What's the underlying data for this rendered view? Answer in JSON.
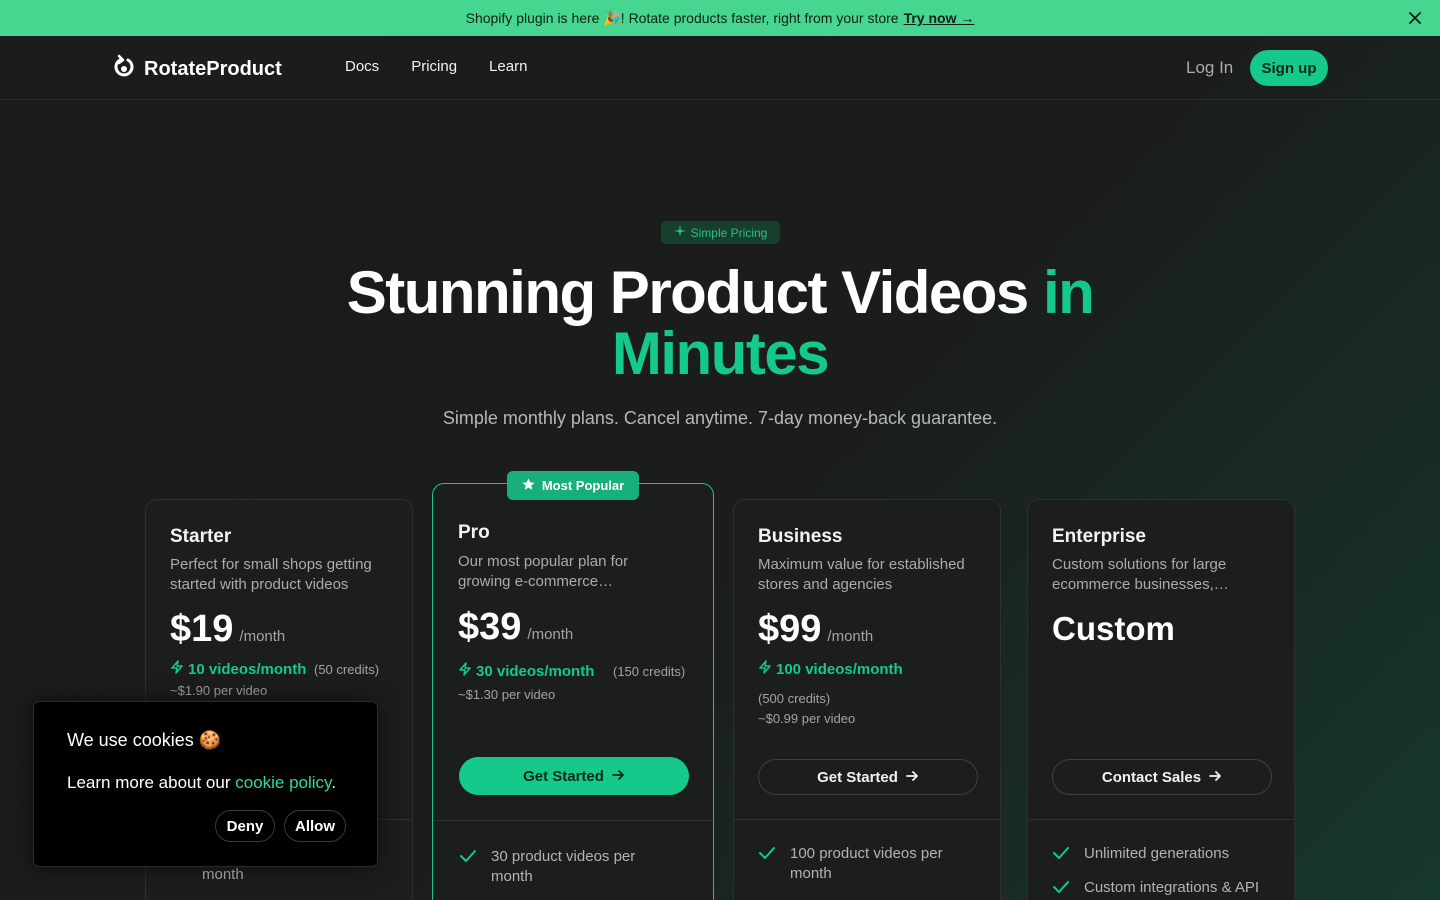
{
  "banner": {
    "text": "Shopify plugin is here 🎉! Rotate products faster, right from your store",
    "link": "Try now →"
  },
  "nav": {
    "logo": "RotateProduct",
    "links": [
      "Docs",
      "Pricing",
      "Learn"
    ],
    "login": "Log In",
    "signup": "Sign up"
  },
  "hero": {
    "pill": "Simple Pricing",
    "title_white": "Stunning Product Videos",
    "title_green_1": "in",
    "title_green_2": "Minutes",
    "subtitle": "Simple monthly plans. Cancel anytime. 7-day money-back guarantee."
  },
  "plans": {
    "starter": {
      "name": "Starter",
      "desc": "Perfect for small shops getting started with product videos",
      "price": "$19",
      "per": "/month",
      "videos": "10 videos/month",
      "credits": "(50 credits)",
      "per_video": "~$1.90 per video",
      "feature_tail": "month"
    },
    "pro": {
      "badge": "Most Popular",
      "name": "Pro",
      "desc": "Our most popular plan for growing e-commerce…",
      "price": "$39",
      "per": "/month",
      "videos": "30 videos/month",
      "credits": "(150 credits)",
      "per_video": "~$1.30 per video",
      "cta": "Get Started",
      "feature_1": "30 product videos per month"
    },
    "business": {
      "name": "Business",
      "desc": "Maximum value for established stores and agencies",
      "price": "$99",
      "per": "/month",
      "videos": "100 videos/month",
      "credits": "(500 credits)",
      "per_video": "~$0.99 per video",
      "cta": "Get Started",
      "feature_1": "100 product videos per month"
    },
    "enterprise": {
      "name": "Enterprise",
      "desc": "Custom solutions for large ecommerce businesses,…",
      "price": "Custom",
      "cta": "Contact Sales",
      "feature_1": "Unlimited generations",
      "feature_2": "Custom integrations & API"
    }
  },
  "cookie": {
    "title": "We use cookies 🍪",
    "text": "Learn more about our",
    "link": "cookie policy",
    "period": ".",
    "deny": "Deny",
    "allow": "Allow"
  },
  "colors": {
    "accent": "#14c98a",
    "banner": "#47d68f",
    "background": "#1b1c1c"
  }
}
